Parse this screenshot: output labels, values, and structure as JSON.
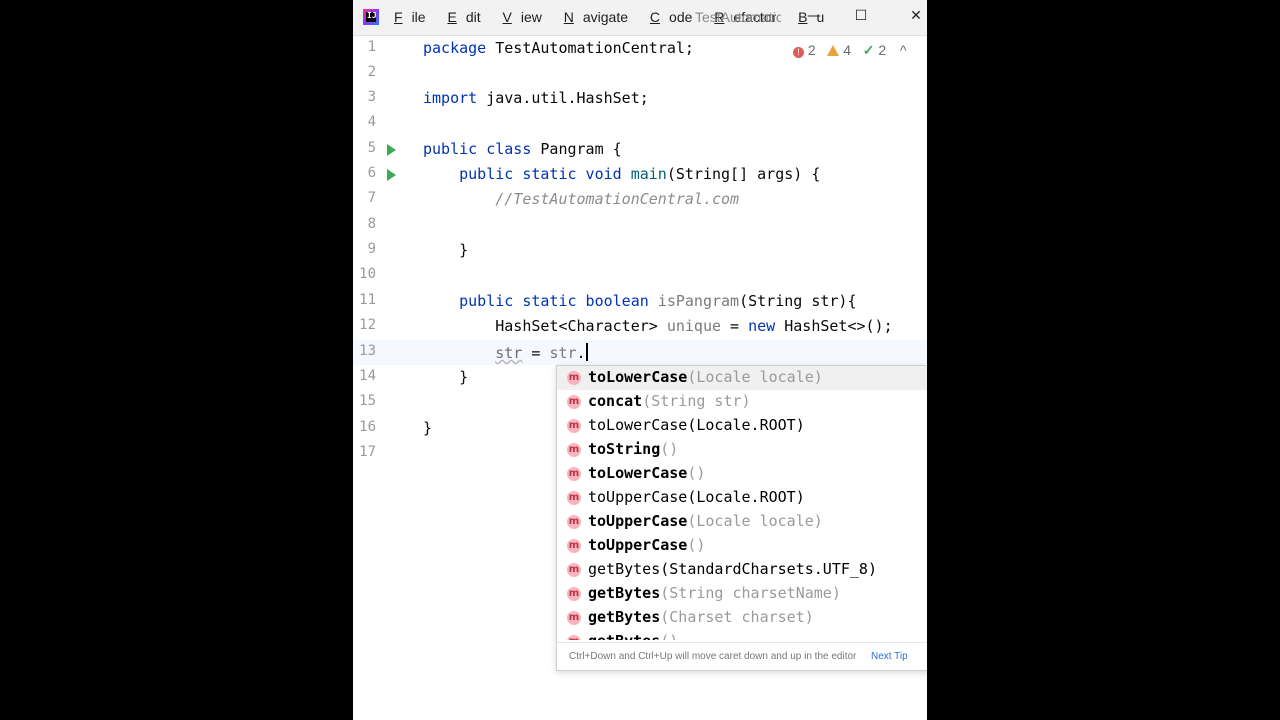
{
  "titlebar": {
    "logo_text": "IJ",
    "menu": [
      {
        "label": "File",
        "underline": "F",
        "rest": "ile"
      },
      {
        "label": "Edit",
        "underline": "E",
        "rest": "dit"
      },
      {
        "label": "View",
        "underline": "V",
        "rest": "iew"
      },
      {
        "label": "Navigate",
        "underline": "N",
        "rest": "avigate"
      },
      {
        "label": "Code",
        "underline": "C",
        "rest": "ode"
      },
      {
        "label": "Refactor",
        "underline": "R",
        "rest": "efactor"
      },
      {
        "label": "Bu",
        "underline": "B",
        "rest": "u"
      }
    ],
    "window_title": "TestAutomatic",
    "minimize": "—",
    "maximize": "☐",
    "close": "✕"
  },
  "inspection": {
    "errors": "2",
    "warnings": "4",
    "ok": "2",
    "up_arrow": "^"
  },
  "editor": {
    "lines": [
      {
        "n": "1",
        "text": "package TestAutomationCentral;"
      },
      {
        "n": "2",
        "text": ""
      },
      {
        "n": "3",
        "text": "import java.util.HashSet;"
      },
      {
        "n": "4",
        "text": ""
      },
      {
        "n": "5",
        "text": "public class Pangram {"
      },
      {
        "n": "6",
        "text": "    public static void main(String[] args) {"
      },
      {
        "n": "7",
        "text": "        //TestAutomationCentral.com"
      },
      {
        "n": "8",
        "text": ""
      },
      {
        "n": "9",
        "text": "    }"
      },
      {
        "n": "10",
        "text": ""
      },
      {
        "n": "11",
        "text": "    public static boolean isPangram(String str){"
      },
      {
        "n": "12",
        "text": "        HashSet<Character> unique = new HashSet<>();"
      },
      {
        "n": "13",
        "text": "        str = str."
      },
      {
        "n": "14",
        "text": "    }"
      },
      {
        "n": "15",
        "text": ""
      },
      {
        "n": "16",
        "text": "}"
      },
      {
        "n": "17",
        "text": ""
      }
    ]
  },
  "completion": {
    "items": [
      {
        "icon": "m",
        "name": "toLowerCase",
        "params": "(Locale locale)",
        "bold": true
      },
      {
        "icon": "m",
        "name": "concat",
        "params": "(String str)",
        "bold": true
      },
      {
        "icon": "m",
        "name": "toLowerCase(Locale.ROOT)",
        "params": "",
        "bold": false
      },
      {
        "icon": "m",
        "name": "toString",
        "params": "()",
        "bold": true
      },
      {
        "icon": "m",
        "name": "toLowerCase",
        "params": "()",
        "bold": true
      },
      {
        "icon": "m",
        "name": "toUpperCase(Locale.ROOT)",
        "params": "",
        "bold": false
      },
      {
        "icon": "m",
        "name": "toUpperCase",
        "params": "(Locale locale)",
        "bold": true
      },
      {
        "icon": "m",
        "name": "toUpperCase",
        "params": "()",
        "bold": true
      },
      {
        "icon": "m",
        "name": "getBytes(StandardCharsets.UTF_8)",
        "params": "",
        "bold": false
      },
      {
        "icon": "m",
        "name": "getBytes",
        "params": "(String charsetName)",
        "bold": true
      },
      {
        "icon": "m",
        "name": "getBytes",
        "params": "(Charset charset)",
        "bold": true
      },
      {
        "icon": "m",
        "name": "getBytes",
        "params": "()",
        "bold": true
      }
    ],
    "hint": "Ctrl+Down and Ctrl+Up will move caret down and up in the editor",
    "next_tip": "Next Tip"
  }
}
